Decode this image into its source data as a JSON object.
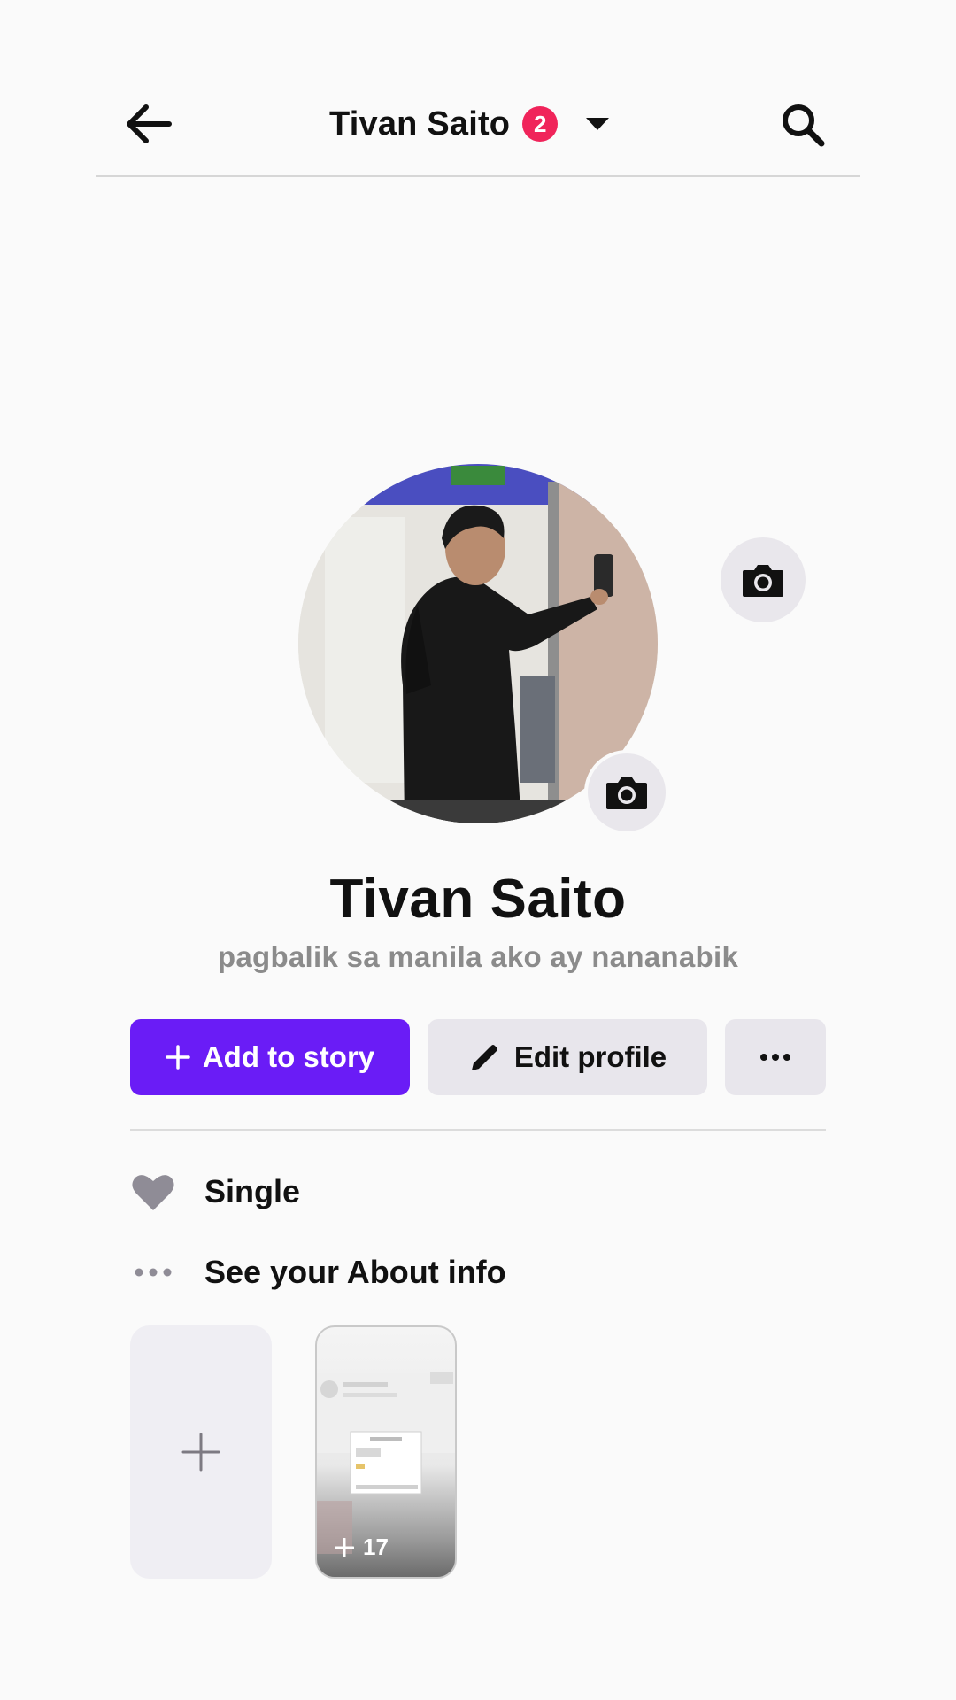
{
  "header": {
    "title": "Tivan Saito",
    "notification_count": "2"
  },
  "profile": {
    "name": "Tivan Saito",
    "bio": "pagbalik sa manila ako ay nananabik"
  },
  "actions": {
    "add_story_label": "Add to story",
    "edit_profile_label": "Edit profile"
  },
  "details": {
    "relationship": "Single",
    "about_link": "See your About info"
  },
  "featured": {
    "photo_count": "17"
  },
  "colors": {
    "accent": "#6a1cf6",
    "badge": "#f0245a",
    "secondary_bg": "#e8e6ec"
  }
}
